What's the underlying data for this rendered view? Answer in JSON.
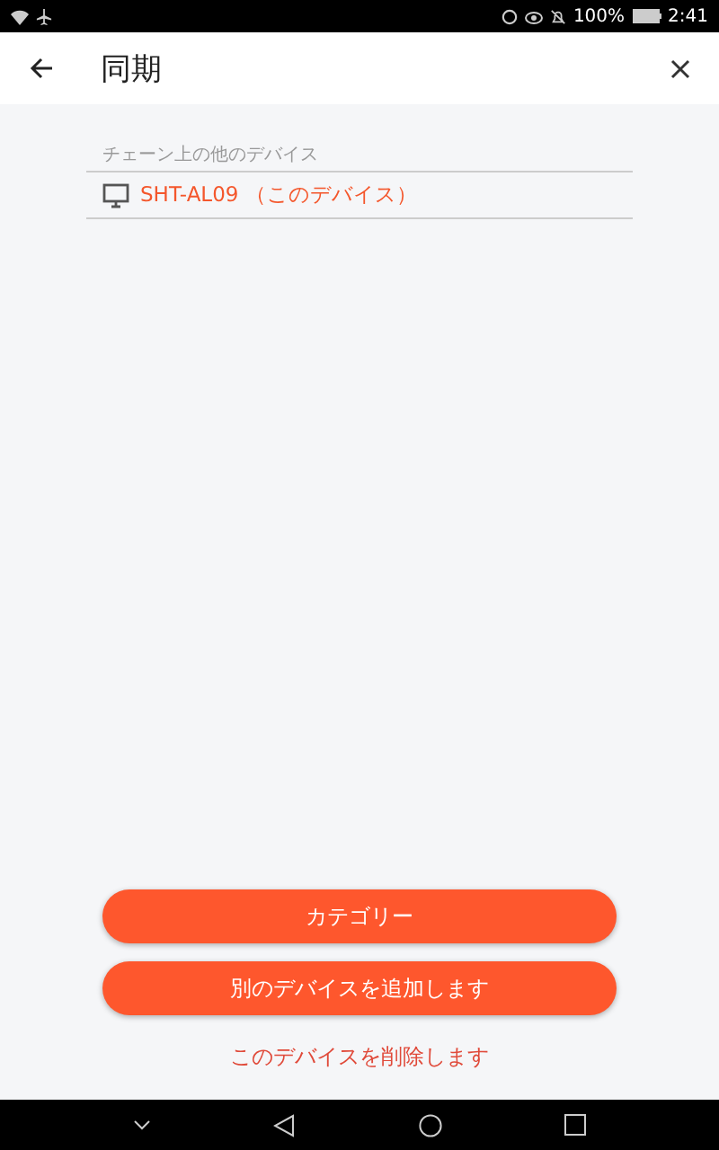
{
  "status_bar": {
    "battery": "100%",
    "time": "2:41"
  },
  "header": {
    "title": "同期"
  },
  "section": {
    "label": "チェーン上の他のデバイス"
  },
  "devices": [
    {
      "name": "SHT-AL09 （このデバイス）"
    }
  ],
  "buttons": [
    {
      "label": "カテゴリー",
      "kind": "primary"
    },
    {
      "label": "別のデバイスを追加します",
      "kind": "primary"
    },
    {
      "label": "このデバイスを削除します",
      "kind": "link"
    }
  ]
}
